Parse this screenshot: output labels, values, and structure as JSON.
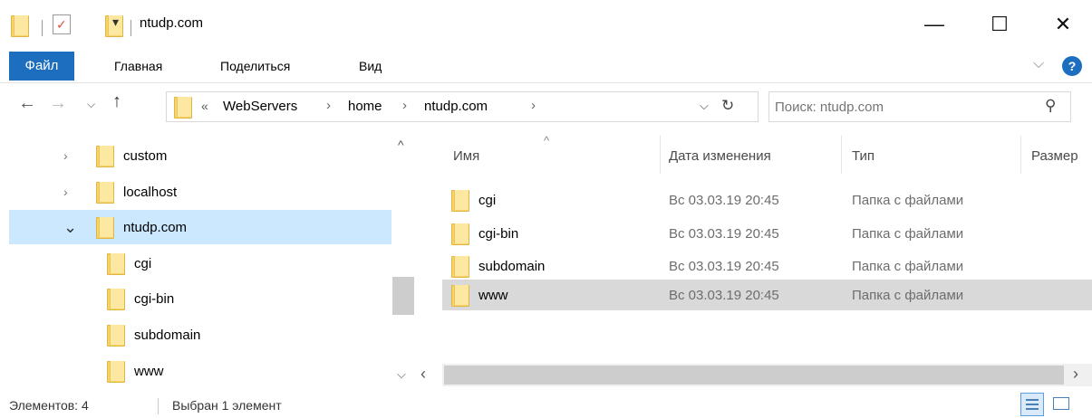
{
  "window": {
    "title": "ntudp.com",
    "qat_dropdown": "▾",
    "minimize": "—",
    "maximize": "☐",
    "close": "✕"
  },
  "ribbon": {
    "tabs": [
      "Файл",
      "Главная",
      "Поделиться",
      "Вид"
    ],
    "expand_chevron": "⌵",
    "help": "?"
  },
  "address": {
    "prefix": "«",
    "crumbs": [
      "WebServers",
      "home",
      "ntudp.com"
    ],
    "separator": "›",
    "dropdown": "⌵",
    "refresh": "↻"
  },
  "search": {
    "placeholder": "Поиск: ntudp.com",
    "icon": "⚲"
  },
  "tree": {
    "items": [
      {
        "label": "custom",
        "expander": "›"
      },
      {
        "label": "localhost",
        "expander": "›"
      },
      {
        "label": "ntudp.com",
        "expander": "⌄"
      },
      {
        "label": "cgi"
      },
      {
        "label": "cgi-bin"
      },
      {
        "label": "subdomain"
      },
      {
        "label": "www"
      }
    ]
  },
  "list": {
    "columns": [
      "Имя",
      "Дата изменения",
      "Тип",
      "Размер"
    ],
    "sort_indicator": "^",
    "rows": [
      {
        "name": "cgi",
        "date": "Вс 03.03.19 20:45",
        "type": "Папка с файлами"
      },
      {
        "name": "cgi-bin",
        "date": "Вс 03.03.19 20:45",
        "type": "Папка с файлами"
      },
      {
        "name": "subdomain",
        "date": "Вс 03.03.19 20:45",
        "type": "Папка с файлами"
      },
      {
        "name": "www",
        "date": "Вс 03.03.19 20:45",
        "type": "Папка с файлами"
      }
    ]
  },
  "scroll": {
    "up": "^",
    "down": "⌵",
    "left": "‹",
    "right": "›"
  },
  "status": {
    "count": "Элементов: 4",
    "selection": "Выбран 1 элемент"
  },
  "colors": {
    "accent": "#1d6ebf",
    "tree_selected": "#cce8ff",
    "row_selected": "#d9d9d9",
    "folder": "#f7d36b"
  }
}
